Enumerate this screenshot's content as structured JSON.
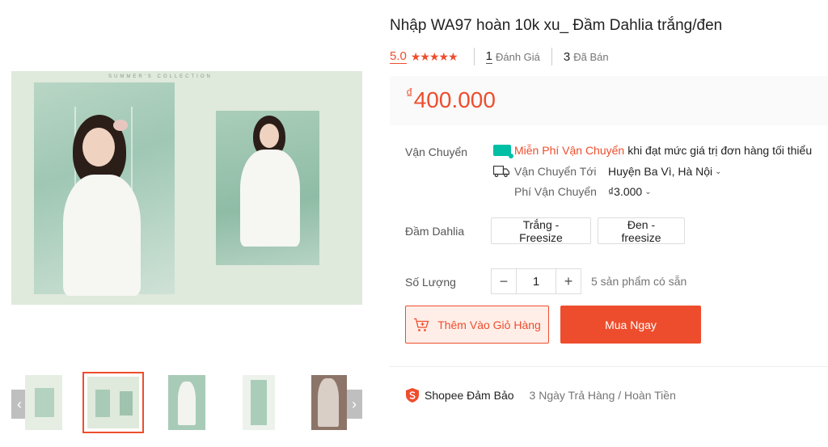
{
  "product": {
    "title": "Nhập WA97 hoàn 10k xu_ Đầm Dahlia trắng/đen",
    "rating": "5.0",
    "stars": "★★★★★",
    "review_count": "1",
    "review_label": "Đánh Giá",
    "sold_count": "3",
    "sold_label": "Đã Bán",
    "currency_symbol": "₫",
    "price": "400.000"
  },
  "gallery": {
    "image_caption": "SUMMER'S COLLECTION",
    "prev_arrow": "‹",
    "next_arrow": "›",
    "thumbnail_count": 5,
    "active_thumbnail": 2
  },
  "shipping": {
    "label": "Vận Chuyển",
    "free_text": "Miễn Phí Vận Chuyển",
    "free_desc": "khi đạt mức giá trị đơn hàng tối thiểu",
    "to_label": "Vận Chuyển Tới",
    "to_value": "Huyện Ba Vì, Hà Nội",
    "fee_label": "Phí Vận Chuyển",
    "fee_value": "₫3.000"
  },
  "variants": {
    "label": "Đầm Dahlia",
    "options": [
      "Trắng - Freesize",
      "Đen - freesize"
    ]
  },
  "quantity": {
    "label": "Số Lượng",
    "minus": "−",
    "value": "1",
    "plus": "+",
    "stock": "5 sản phẩm có sẵn"
  },
  "actions": {
    "add_to_cart": "Thêm Vào Giỏ Hàng",
    "buy_now": "Mua Ngay"
  },
  "guarantee": {
    "label": "Shopee Đảm Bảo",
    "desc": "3 Ngày Trả Hàng / Hoàn Tiền"
  },
  "colors": {
    "accent": "#ee4d2d",
    "free_ship": "#00bfa5"
  }
}
